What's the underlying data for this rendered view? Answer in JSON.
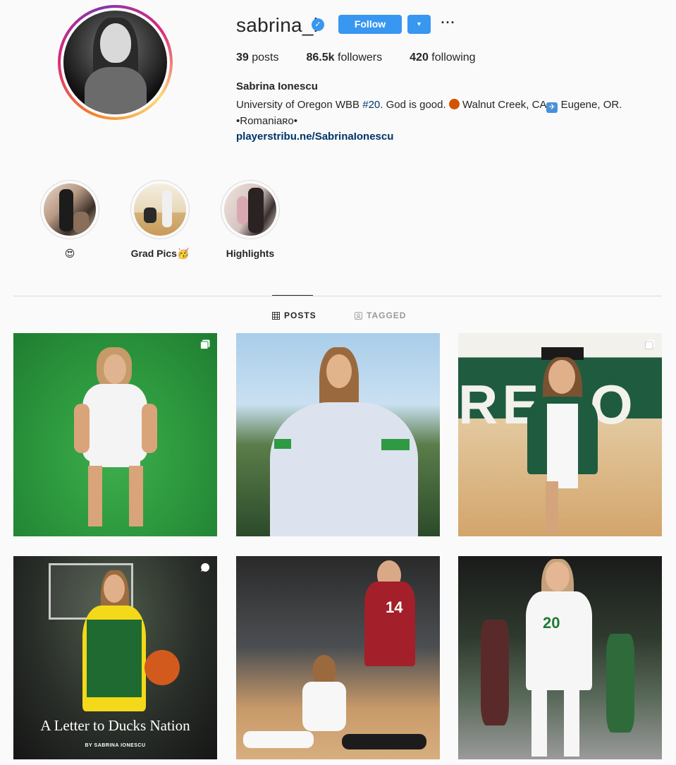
{
  "profile": {
    "username": "sabrina_i",
    "verified_glyph": "✓",
    "follow_label": "Follow",
    "dropdown_glyph": "▾",
    "more_glyph": "···",
    "stats": {
      "posts_count": "39",
      "posts_label": "posts",
      "followers_count": "86.5k",
      "followers_label": "followers",
      "following_count": "420",
      "following_label": "following"
    },
    "full_name": "Sabrina Ionescu",
    "bio": {
      "part1": "University of Oregon WBB ",
      "hashtag": "#20",
      "part2": ". God is good. ",
      "part3": " Walnut Creek, CA",
      "part4": " Eugene, OR.",
      "line2": "•Romaniaʀᴏ•"
    },
    "link": "playerstribu.ne/SabrinaIonescu"
  },
  "highlights": [
    {
      "label": "😍",
      "icon": "highlight-cover-1"
    },
    {
      "label": "Grad Pics🥳",
      "icon": "highlight-cover-2"
    },
    {
      "label": "Highlights",
      "icon": "highlight-cover-3"
    }
  ],
  "tabs": {
    "posts": "POSTS",
    "tagged": "TAGGED"
  },
  "posts": [
    {
      "type": "carousel",
      "icon": "carousel-icon"
    },
    {
      "type": "photo"
    },
    {
      "type": "carousel",
      "icon": "carousel-icon"
    },
    {
      "type": "igtv",
      "icon": "igtv-icon",
      "caption": "A Letter to Ducks Nation",
      "byline": "BY SABRINA IONESCU"
    },
    {
      "type": "photo"
    },
    {
      "type": "photo"
    }
  ],
  "colors": {
    "accent": "#3897f0",
    "link": "#003569",
    "oregon_green": "#154733",
    "oregon_yellow": "#fee11a",
    "indiana_red": "#990000"
  }
}
